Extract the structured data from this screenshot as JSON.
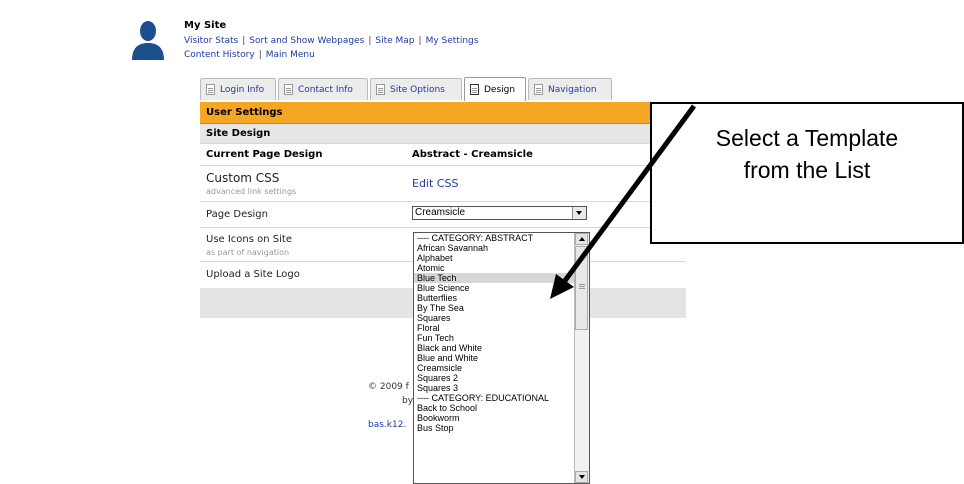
{
  "header": {
    "site_title": "My Site",
    "nav_row1": [
      "Visitor Stats",
      "Sort and Show Webpages",
      "Site Map",
      "My Settings"
    ],
    "nav_row1_sep": "|",
    "nav_row2": [
      "Content History",
      "Main Menu"
    ]
  },
  "tabs": [
    {
      "label": "Login Info",
      "active": false
    },
    {
      "label": "Contact Info",
      "active": false
    },
    {
      "label": "Site Options",
      "active": false
    },
    {
      "label": "Design",
      "active": true
    },
    {
      "label": "Navigation",
      "active": false
    }
  ],
  "panel": {
    "user_settings": "User Settings",
    "site_design": "Site Design",
    "current_design_label": "Current Page Design",
    "current_design_value": "Abstract - Creamsicle",
    "custom_css_label": "Custom CSS",
    "custom_css_sub": "advanced link settings",
    "edit_css": "Edit CSS",
    "page_design_label": "Page Design",
    "page_design_selected": "Creamsicle",
    "use_icons_label": "Use Icons on Site",
    "use_icons_sub": "as part of navigation",
    "upload_logo_label": "Upload a Site Logo"
  },
  "design_options": [
    "---- CATEGORY: ABSTRACT",
    "African Savannah",
    "Alphabet",
    "Atomic",
    "Blue Tech",
    "Blue Science",
    "Butterflies",
    "By The Sea",
    "Squares",
    "Floral",
    "Fun Tech",
    "Black and White",
    "Blue and White",
    "Creamsicle",
    "Squares 2",
    "Squares 3",
    "---- CATEGORY: EDUCATIONAL",
    "Back to School",
    "Bookworm",
    "Bus Stop"
  ],
  "highlighted_option": "Blue Tech",
  "footer": {
    "copyright": "© 2009 f",
    "byline": "by",
    "domain": "bas.k12."
  },
  "callout": {
    "line1": "Select a Template",
    "line2": "from the List"
  },
  "colors": {
    "user_settings_bar": "#f5a623",
    "link": "#1f3aa0"
  }
}
